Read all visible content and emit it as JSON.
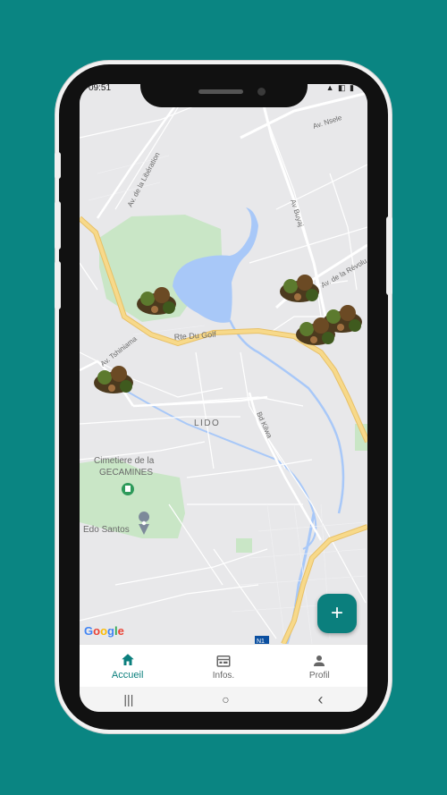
{
  "statusbar": {
    "time": "09:51",
    "icons": "▲ ◧ ▮"
  },
  "map": {
    "streets": {
      "av_nsele": "Av. Nsele",
      "av_liberation": "Av. de la Libération",
      "av_buyaj": "Av Buyaj",
      "av_revolution": "Av. de la Révolu",
      "rte_du_golf": "Rte Du Golf",
      "av_tshiniama": "Av. Tshiniama",
      "lido": "LIDO",
      "bd_kilwa": "Bd Kilwa",
      "cemetery_line1": "Cimetiere de la",
      "cemetery_line2": "GECAMINES",
      "edo_santos": "Edo Santos",
      "n1": "N1"
    },
    "google_logo": [
      "G",
      "o",
      "o",
      "g",
      "l",
      "e"
    ],
    "marker_count": 5
  },
  "fab": {
    "label": "+"
  },
  "bottom_nav": {
    "items": [
      {
        "label": "Accueil",
        "icon": "home-icon",
        "active": true
      },
      {
        "label": "Infos.",
        "icon": "calendar-icon",
        "active": false
      },
      {
        "label": "Profil",
        "icon": "person-icon",
        "active": false
      }
    ]
  },
  "system_nav": {
    "recents": "|||",
    "home": "○",
    "back": "‹"
  },
  "colors": {
    "background": "#0a8582",
    "accent": "#0b7f7d",
    "road_major": "#f5d27a",
    "water": "#a8c8f8",
    "park": "#c9e6c6"
  }
}
